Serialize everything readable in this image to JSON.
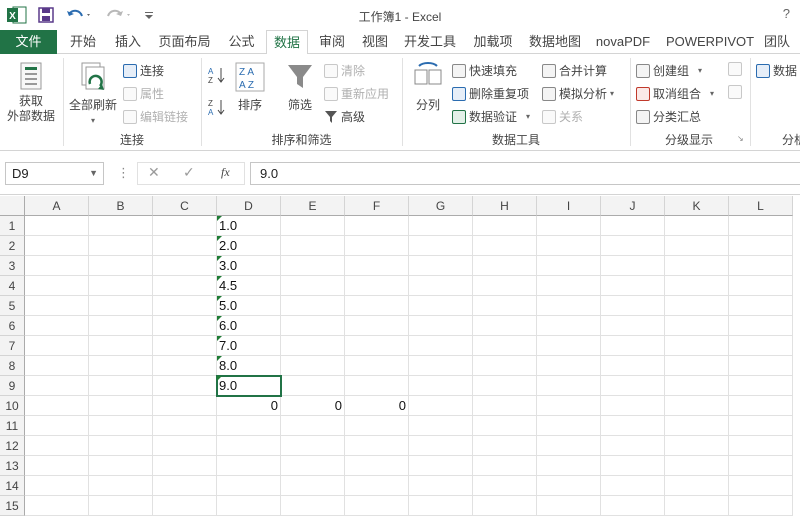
{
  "window": {
    "title": "工作簿1 - Excel",
    "help": "?"
  },
  "quick_access": {
    "save": "save-icon",
    "undo": "undo-icon",
    "redo": "redo-icon",
    "customize": "customize-icon"
  },
  "tabs": {
    "file": "文件",
    "items": [
      "开始",
      "插入",
      "页面布局",
      "公式",
      "数据",
      "审阅",
      "视图",
      "开发工具",
      "加载项",
      "数据地图",
      "novaPDF",
      "POWERPIVOT",
      "团队"
    ],
    "active": "数据"
  },
  "ribbon": {
    "get_external": {
      "line1": "获取",
      "line2": "外部数据"
    },
    "refresh_all": "全部刷新",
    "connections": {
      "connect": "连接",
      "properties": "属性",
      "edit_links": "编辑链接",
      "label": "连接"
    },
    "sort_filter": {
      "sort": "排序",
      "filter": "筛选",
      "clear": "清除",
      "reapply": "重新应用",
      "advanced": "高级",
      "label": "排序和筛选"
    },
    "data_tools": {
      "split": "分列",
      "flash_fill": "快速填充",
      "remove_dup": "删除重复项",
      "validate": "数据验证",
      "consolidate": "合并计算",
      "whatif": "模拟分析",
      "relations": "关系",
      "label": "数据工具"
    },
    "outline": {
      "group": "创建组",
      "ungroup": "取消组合",
      "subtotal": "分类汇总",
      "label": "分级显示"
    },
    "analysis": {
      "data": "数据",
      "label": "分析"
    }
  },
  "formula_bar": {
    "name_box": "D9",
    "cancel": "✕",
    "enter": "✓",
    "fx": "fx",
    "value": "9.0"
  },
  "sheet": {
    "columns": [
      "A",
      "B",
      "C",
      "D",
      "E",
      "F",
      "G",
      "H",
      "I",
      "J",
      "K",
      "L"
    ],
    "rows": [
      "1",
      "2",
      "3",
      "4",
      "5",
      "6",
      "7",
      "8",
      "9",
      "10",
      "11",
      "12",
      "13",
      "14",
      "15"
    ],
    "cells": {
      "D1": "1.0",
      "D2": "2.0",
      "D3": "3.0",
      "D4": "4.5",
      "D5": "5.0",
      "D6": "6.0",
      "D7": "7.0",
      "D8": "8.0",
      "D9": "9.0",
      "D10": "0",
      "E10": "0",
      "F10": "0"
    },
    "active_cell": "D9"
  }
}
